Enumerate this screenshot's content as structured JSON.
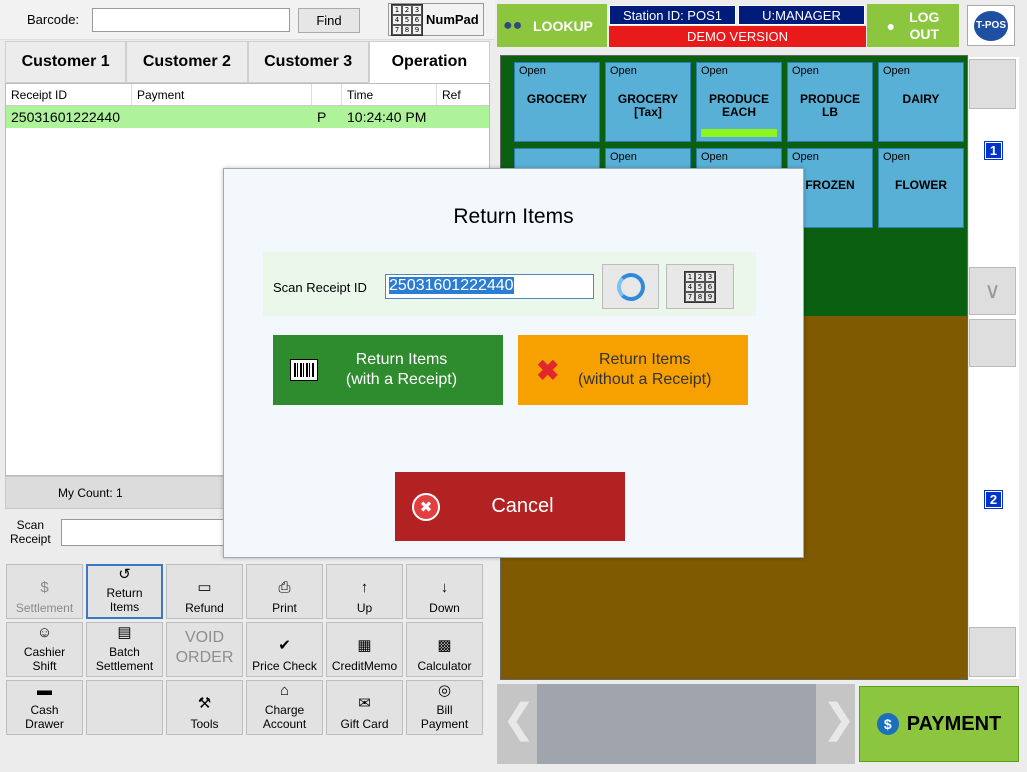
{
  "topbar": {
    "barcode_label": "Barcode:",
    "barcode_value": "",
    "find_label": "Find",
    "numpad_label": "NumPad",
    "numpad_keys": [
      "1",
      "2",
      "3",
      "4",
      "5",
      "6",
      "7",
      "8",
      "9"
    ]
  },
  "tabs": [
    "Customer 1",
    "Customer 2",
    "Customer 3",
    "Operation"
  ],
  "active_tab": "Operation",
  "receipt_table": {
    "columns": [
      "Receipt ID",
      "Payment",
      "",
      "Time",
      "Ref"
    ],
    "rows": [
      {
        "receipt_id": "25031601222440",
        "payment": "",
        "status": "P",
        "time": "10:24:40 PM",
        "ref": ""
      }
    ]
  },
  "my_count": "My Count: 1",
  "scan_receipt_label": "Scan\nReceipt",
  "functions": [
    {
      "label": "Settlement",
      "icon": "dollar-icon",
      "disabled": true
    },
    {
      "label": "Return\nItems",
      "icon": "return-icon",
      "selected": true
    },
    {
      "label": "Refund",
      "icon": "visa-card-icon"
    },
    {
      "label": "Print",
      "icon": "printer-icon"
    },
    {
      "label": "Up",
      "icon": "arrow-up-icon"
    },
    {
      "label": "Down",
      "icon": "arrow-down-icon"
    },
    {
      "label": "Cashier\nShift",
      "icon": "cashier-icon"
    },
    {
      "label": "Batch\nSettlement",
      "icon": "batch-icon"
    },
    {
      "label": "VOID\nORDER",
      "icon": "",
      "disabled": true
    },
    {
      "label": "Price Check",
      "icon": "checkmark-icon"
    },
    {
      "label": "CreditMemo",
      "icon": "memo-icon"
    },
    {
      "label": "Calculator",
      "icon": "calculator-icon"
    },
    {
      "label": "Cash\nDrawer",
      "icon": "cash-drawer-icon"
    },
    {
      "label": "",
      "icon": ""
    },
    {
      "label": "Tools",
      "icon": "tools-icon"
    },
    {
      "label": "Charge\nAccount",
      "icon": "house-icon"
    },
    {
      "label": "Gift Card",
      "icon": "gift-icon"
    },
    {
      "label": "Bill\nPayment",
      "icon": "coins-icon"
    }
  ],
  "header": {
    "lookup_label": "LOOKUP",
    "station_id": "Station ID: POS1",
    "user": "U:MANAGER",
    "demo_banner": "DEMO VERSION",
    "logout_label": "LOG\nOUT",
    "logo_text": "T-POS"
  },
  "categories": [
    {
      "status": "Open",
      "name": "GROCERY"
    },
    {
      "status": "Open",
      "name": "GROCERY\n[Tax]"
    },
    {
      "status": "Open",
      "name": "PRODUCE\nEACH",
      "selected": true
    },
    {
      "status": "Open",
      "name": "PRODUCE\nLB"
    },
    {
      "status": "Open",
      "name": "DAIRY"
    },
    {
      "status": "",
      "name": ""
    },
    {
      "status": "Open",
      "name": ""
    },
    {
      "status": "Open",
      "name": ""
    },
    {
      "status": "Open",
      "name": "FROZEN"
    },
    {
      "status": "Open",
      "name": "FLOWER"
    }
  ],
  "page_numbers": [
    "1",
    "2"
  ],
  "payment_label": "PAYMENT",
  "dialog": {
    "title": "Return Items",
    "scan_label": "Scan Receipt ID",
    "scan_value": "25031601222440",
    "return_with_label": "Return Items\n(with a Receipt)",
    "return_without_label": "Return Items\n(without a Receipt)",
    "cancel_label": "Cancel"
  },
  "colors": {
    "accent_green": "#8cc63f",
    "station_blue": "#001b7a",
    "demo_red": "#e81a1a",
    "category_blue": "#59b0d6",
    "return_with": "#2e8b2e",
    "return_without": "#f7a100",
    "cancel": "#b22222"
  }
}
